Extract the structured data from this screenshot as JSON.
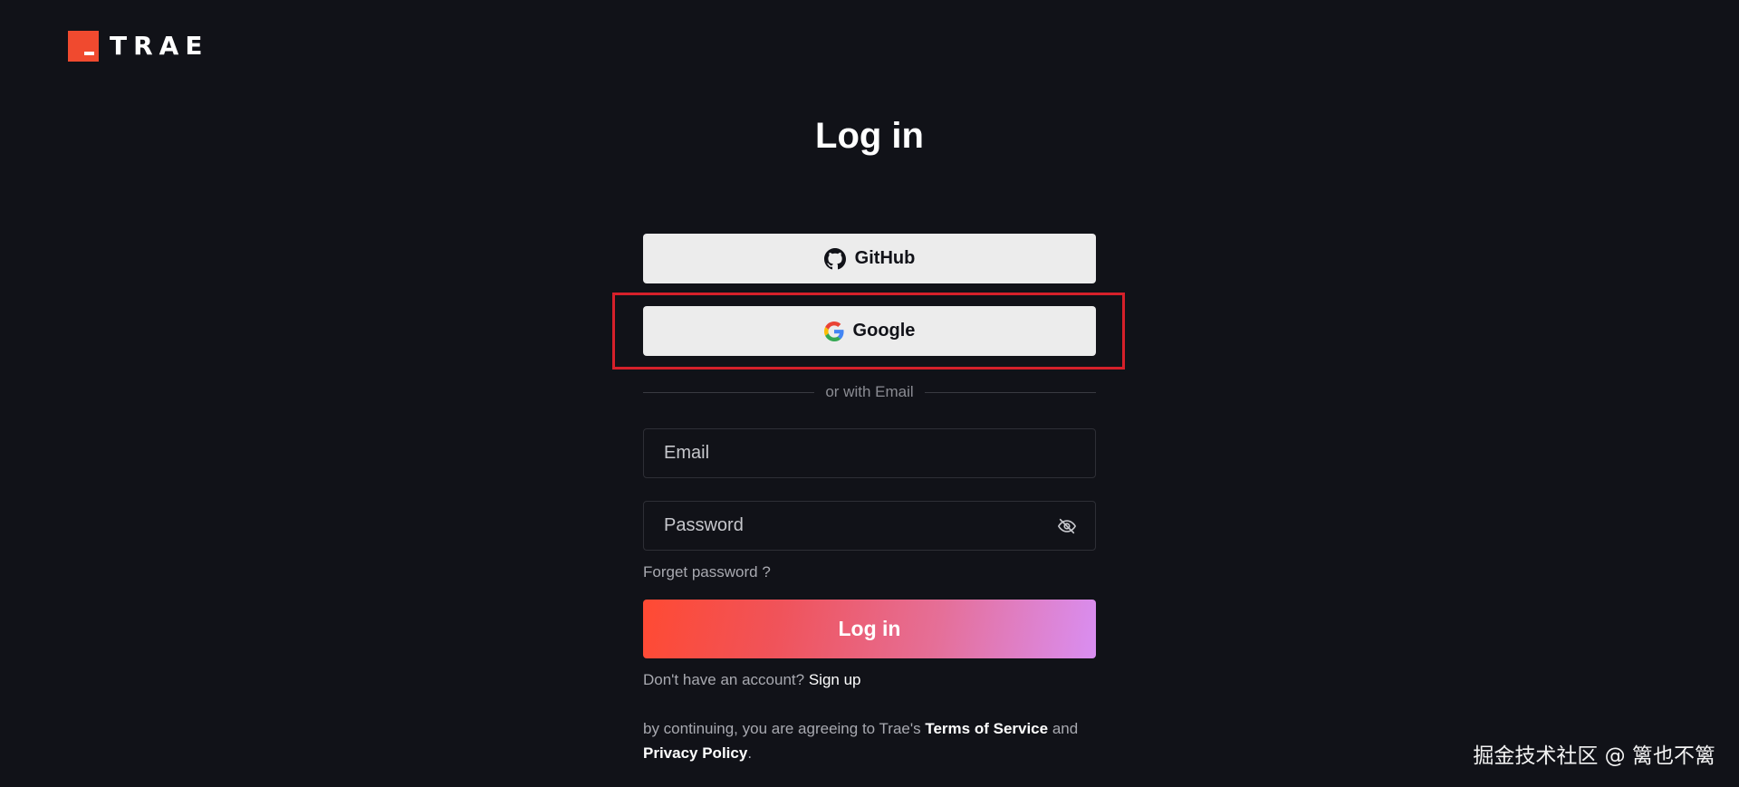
{
  "logo": {
    "text": "TRAE"
  },
  "title": "Log in",
  "oauth": {
    "github_label": "GitHub",
    "google_label": "Google"
  },
  "divider_text": "or with Email",
  "email": {
    "placeholder": "Email"
  },
  "password": {
    "placeholder": "Password"
  },
  "forgot_label": "Forget password ?",
  "login_label": "Log in",
  "signup": {
    "prompt": "Don't have an account?",
    "link": "Sign up"
  },
  "terms": {
    "prefix": "by continuing, you are agreeing to Trae's",
    "tos": "Terms of Service",
    "and": "and",
    "privacy": "Privacy Policy",
    "suffix": "."
  },
  "watermark": "掘金技术社区 @ 篱也不篱",
  "colors": {
    "background": "#111218",
    "brand": "#f04a2f",
    "highlight": "#d6202a",
    "gradient_start": "#ff4a33",
    "gradient_end": "#d98ef2"
  },
  "icons": {
    "github": "github-icon",
    "google": "google-icon",
    "password_toggle": "eye-off-icon"
  }
}
